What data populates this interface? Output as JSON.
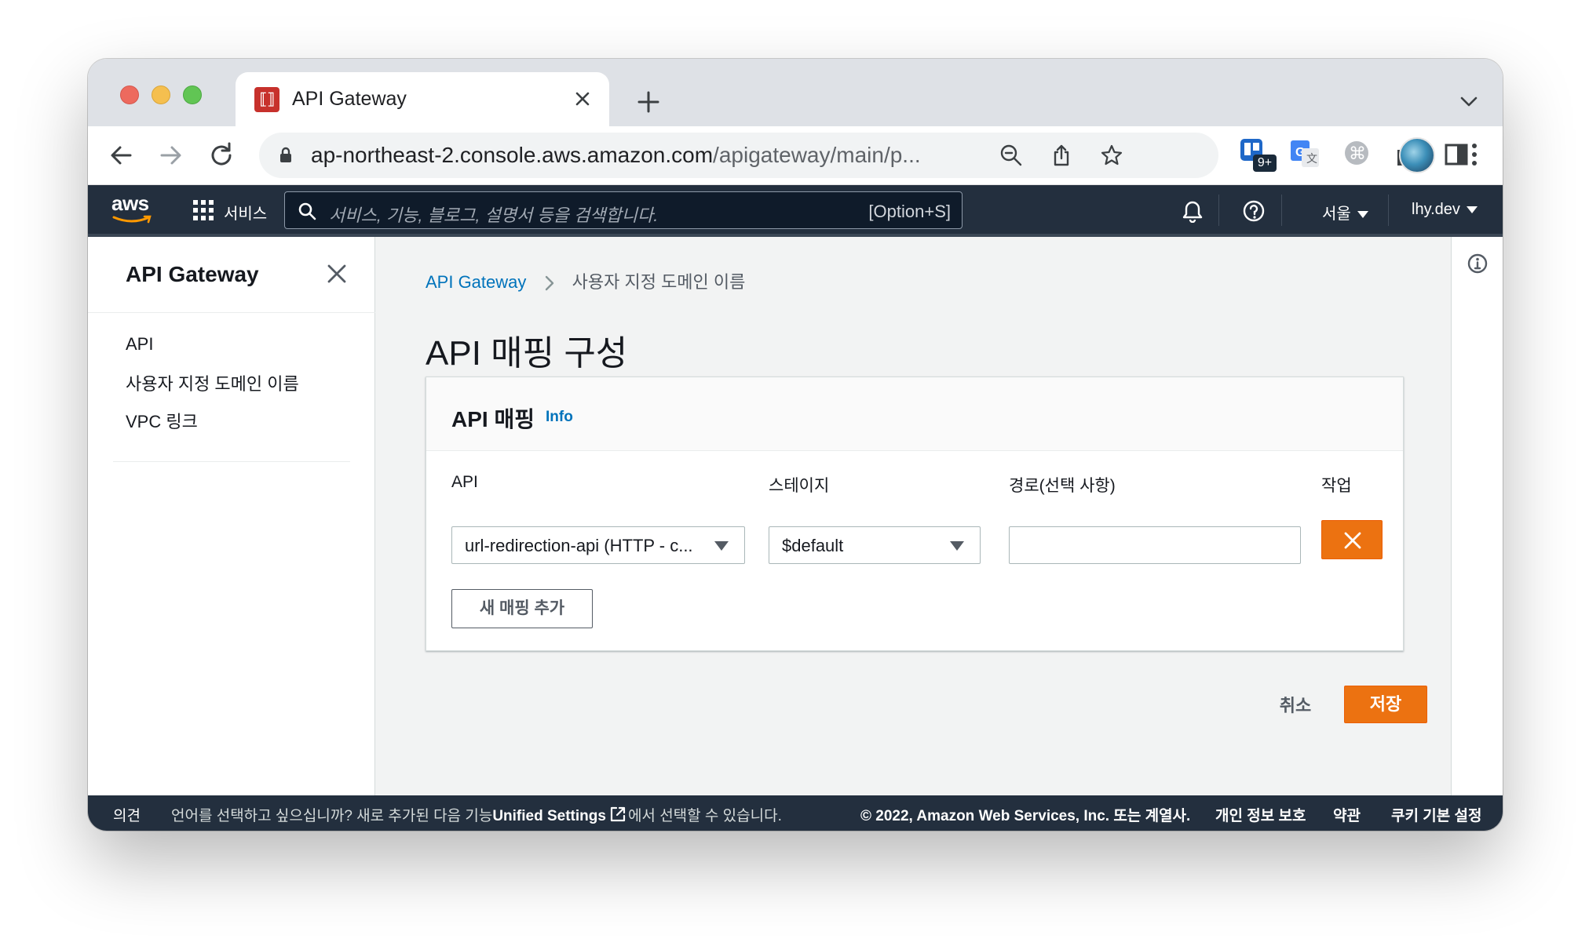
{
  "browser": {
    "tab_title": "API Gateway",
    "url_host": "ap-northeast-2.console.aws.amazon.com",
    "url_path": "/apigateway/main/p...",
    "extension_badge": "9+"
  },
  "aws_nav": {
    "logo": "aws",
    "services_label": "서비스",
    "search_placeholder": "서비스, 기능, 블로그, 설명서 등을 검색합니다.",
    "search_shortcut": "[Option+S]",
    "region": "서울",
    "account": "lhy.dev"
  },
  "sidebar": {
    "title": "API Gateway",
    "items": [
      {
        "label": "API"
      },
      {
        "label": "사용자 지정 도메인 이름"
      },
      {
        "label": "VPC 링크"
      }
    ]
  },
  "breadcrumb": {
    "parent": "API Gateway",
    "current": "사용자 지정 도메인 이름"
  },
  "page": {
    "title": "API 매핑 구성"
  },
  "panel": {
    "title": "API 매핑",
    "info_link": "Info",
    "columns": {
      "api": "API",
      "stage": "스테이지",
      "path": "경로(선택 사항)",
      "action": "작업"
    },
    "row": {
      "api_value": "url-redirection-api (HTTP - c...",
      "stage_value": "$default",
      "path_value": ""
    },
    "add_mapping_label": "새 매핑 추가"
  },
  "actions": {
    "cancel_label": "취소",
    "save_label": "저장"
  },
  "footer": {
    "feedback": "의견",
    "language_prefix": "언어를 선택하고 싶으십니까? 새로 추가된 다음 기능",
    "unified_settings": "Unified Settings",
    "language_suffix": "에서 선택할 수 있습니다.",
    "copyright": "© 2022, Amazon Web Services, Inc. 또는 계열사.",
    "privacy": "개인 정보 보호",
    "terms": "약관",
    "cookie_settings": "쿠키 기본 설정"
  },
  "colors": {
    "aws_nav_bg": "#232f3e",
    "primary_orange": "#ec7211",
    "link_blue": "#0073bb",
    "content_bg": "#f2f3f3"
  }
}
